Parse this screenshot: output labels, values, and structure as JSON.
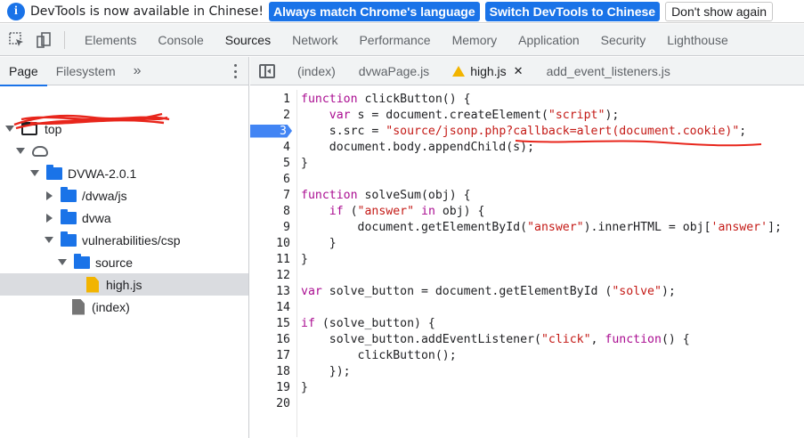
{
  "infobar": {
    "message": "DevTools is now available in Chinese!",
    "btn_match": "Always match Chrome's language",
    "btn_switch": "Switch DevTools to Chinese",
    "btn_dismiss": "Don't show again"
  },
  "main_tabs": [
    "Elements",
    "Console",
    "Sources",
    "Network",
    "Performance",
    "Memory",
    "Application",
    "Security",
    "Lighthouse"
  ],
  "active_main_tab": "Sources",
  "navigator": {
    "tabs": [
      "Page",
      "Filesystem"
    ],
    "more": "»",
    "tree": [
      {
        "label": "top"
      },
      {
        "label": ""
      },
      {
        "label": "DVWA-2.0.1"
      },
      {
        "label": "/dvwa/js"
      },
      {
        "label": "dvwa"
      },
      {
        "label": "vulnerabilities/csp"
      },
      {
        "label": "source"
      },
      {
        "label": "high.js"
      },
      {
        "label": "(index)"
      }
    ]
  },
  "editor": {
    "tabs": [
      "(index)",
      "dvwaPage.js",
      "high.js",
      "add_event_listeners.js"
    ],
    "close_glyph": "✕",
    "line_numbers": [
      "1",
      "2",
      "3",
      "4",
      "5",
      "6",
      "7",
      "8",
      "9",
      "10",
      "11",
      "12",
      "13",
      "14",
      "15",
      "16",
      "17",
      "18",
      "19",
      "20"
    ],
    "breakpoint_line": "3"
  },
  "colors": {
    "accent": "#1a73e8",
    "keyword": "#aa0d91",
    "string": "#c41a16",
    "scribble": "#e8261c"
  }
}
